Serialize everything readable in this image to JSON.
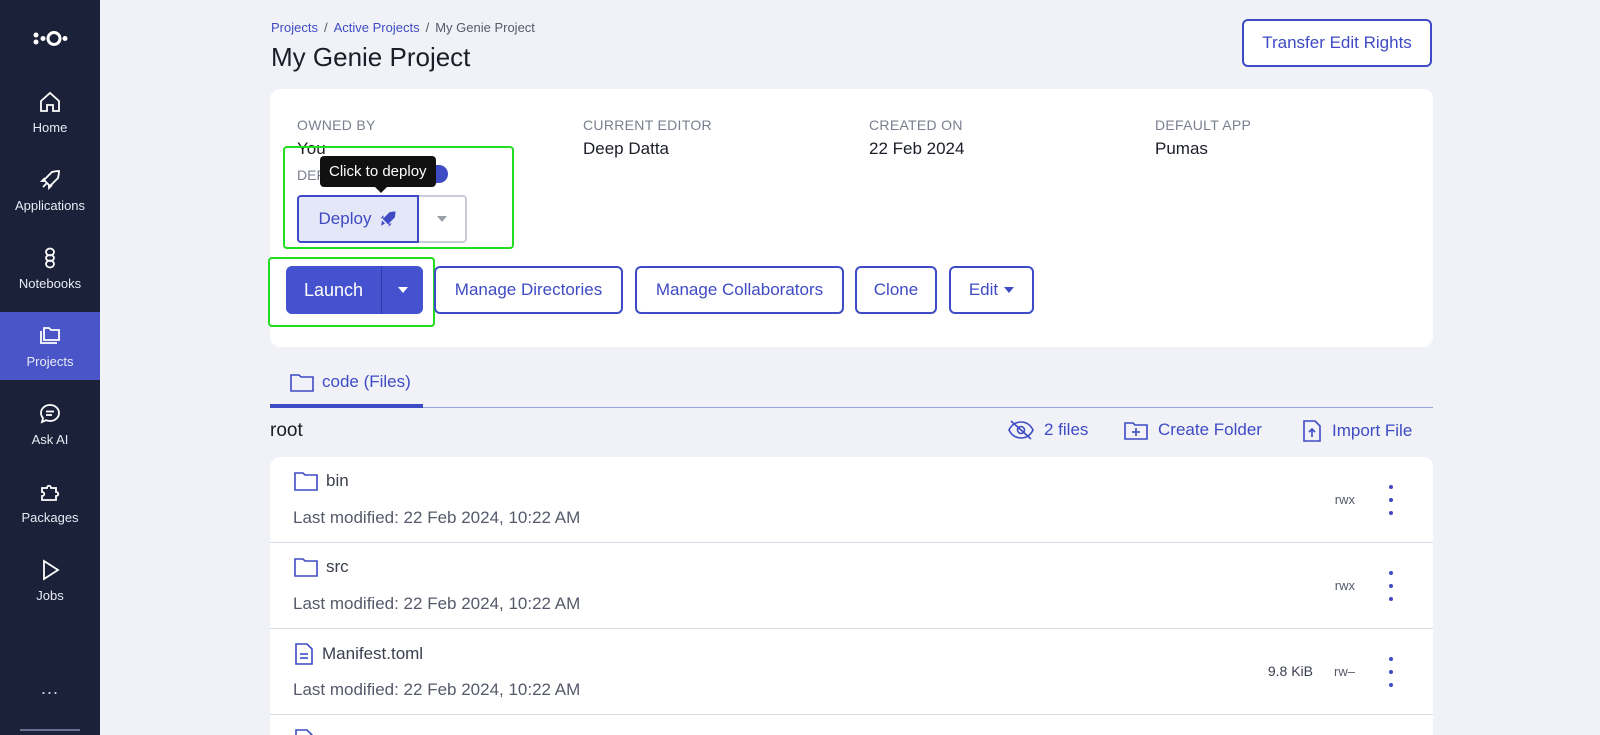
{
  "sidebar": {
    "items": [
      {
        "label": "Home",
        "icon": "home-icon"
      },
      {
        "label": "Applications",
        "icon": "rocket-icon"
      },
      {
        "label": "Notebooks",
        "icon": "notebook-icon"
      },
      {
        "label": "Projects",
        "icon": "folders-icon",
        "active": true
      },
      {
        "label": "Ask AI",
        "icon": "chat-icon"
      },
      {
        "label": "Packages",
        "icon": "puzzle-icon"
      },
      {
        "label": "Jobs",
        "icon": "play-icon"
      }
    ],
    "more": "..."
  },
  "breadcrumb": {
    "items": [
      "Projects",
      "Active Projects",
      "My Genie Project"
    ],
    "separator": "/"
  },
  "header": {
    "title": "My Genie Project",
    "transfer_label": "Transfer Edit Rights"
  },
  "info": {
    "owned_by": {
      "label": "OWNED BY",
      "value": "You"
    },
    "current_editor": {
      "label": "CURRENT EDITOR",
      "value": "Deep Datta"
    },
    "created_on": {
      "label": "CREATED ON",
      "value": "22 Feb 2024"
    },
    "default_app": {
      "label": "DEFAULT APP",
      "value": "Pumas"
    },
    "deploy_label_partial": "DEF"
  },
  "deploy": {
    "label": "Deploy",
    "tooltip": "Click to deploy"
  },
  "actions": {
    "launch": "Launch",
    "manage_directories": "Manage Directories",
    "manage_collaborators": "Manage Collaborators",
    "clone": "Clone",
    "edit": "Edit"
  },
  "tabs": [
    {
      "label": "code (Files)",
      "active": true
    }
  ],
  "files_panel": {
    "root_label": "root",
    "hidden_files": "2 files",
    "create_folder": "Create Folder",
    "import_file": "Import File"
  },
  "files": [
    {
      "name": "bin",
      "type": "folder",
      "modified": "Last modified: 22 Feb 2024, 10:22 AM",
      "size": "",
      "perm": "rwx"
    },
    {
      "name": "src",
      "type": "folder",
      "modified": "Last modified: 22 Feb 2024, 10:22 AM",
      "size": "",
      "perm": "rwx"
    },
    {
      "name": "Manifest.toml",
      "type": "file",
      "modified": "Last modified: 22 Feb 2024, 10:22 AM",
      "size": "9.8 KiB",
      "perm": "rw–"
    }
  ],
  "colors": {
    "accent": "#3e4bc4",
    "sidebar_bg": "#1a2138",
    "sidebar_active": "#4a55c8",
    "highlight": "#22dd22"
  }
}
